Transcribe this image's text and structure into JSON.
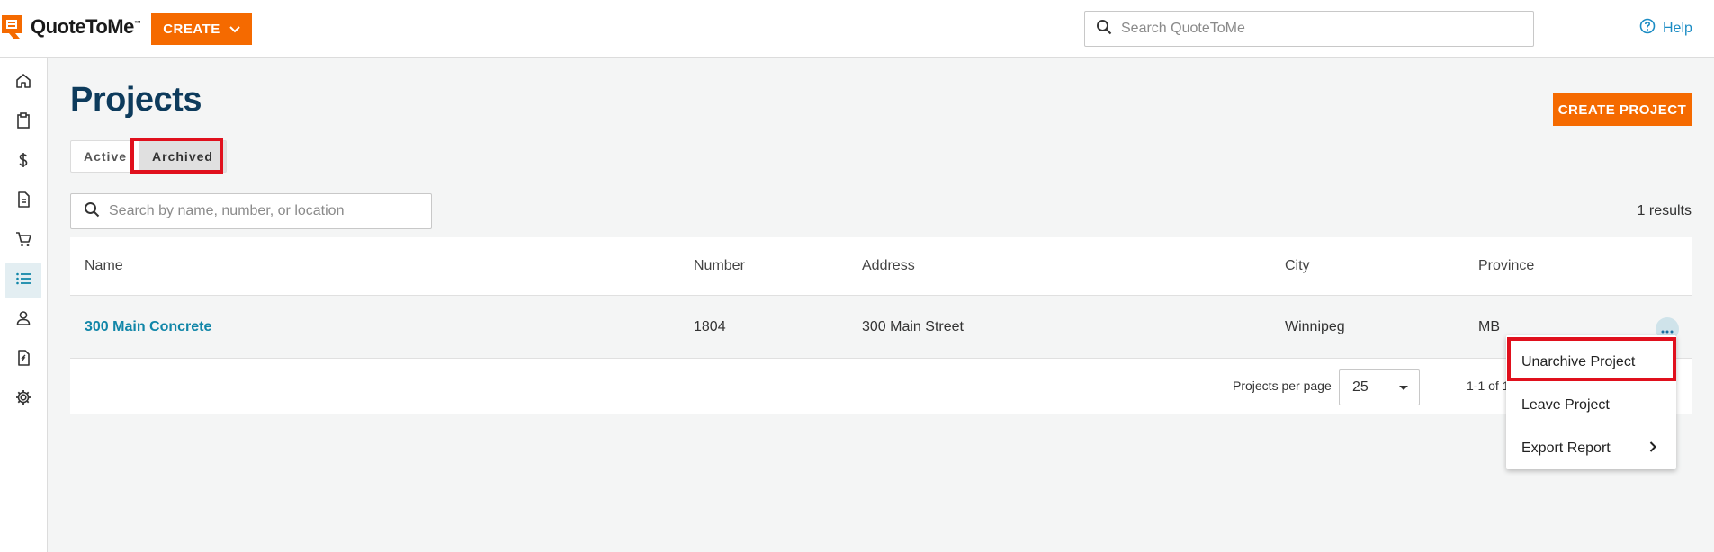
{
  "app": {
    "name": "QuoteToMe",
    "trademark": "™"
  },
  "header": {
    "create_label": "CREATE",
    "search_placeholder": "Search QuoteToMe",
    "help_label": "Help"
  },
  "sidebar": {
    "items": [
      {
        "name": "home",
        "icon": "home-icon"
      },
      {
        "name": "quotes",
        "icon": "clipboard-icon"
      },
      {
        "name": "pricing",
        "icon": "dollar-icon"
      },
      {
        "name": "documents",
        "icon": "document-icon"
      },
      {
        "name": "orders",
        "icon": "cart-icon"
      },
      {
        "name": "projects",
        "icon": "list-icon",
        "active": true
      },
      {
        "name": "contacts",
        "icon": "person-icon"
      },
      {
        "name": "reports",
        "icon": "report-icon"
      },
      {
        "name": "settings",
        "icon": "gear-icon"
      }
    ]
  },
  "page": {
    "title": "Projects",
    "create_project_label": "CREATE PROJECT",
    "tabs": [
      {
        "label": "Active",
        "selected": false
      },
      {
        "label": "Archived",
        "selected": true
      }
    ],
    "search_placeholder": "Search by name, number, or location",
    "results_text": "1 results"
  },
  "table": {
    "columns": [
      "Name",
      "Number",
      "Address",
      "City",
      "Province"
    ],
    "rows": [
      {
        "name": "300 Main Concrete",
        "number": "1804",
        "address": "300 Main Street",
        "city": "Winnipeg",
        "province": "MB"
      }
    ],
    "per_page_label": "Projects per page",
    "per_page_value": "25",
    "range_text": "1-1 of 1"
  },
  "row_menu": {
    "items": [
      {
        "label": "Unarchive Project"
      },
      {
        "label": "Leave Project"
      },
      {
        "label": "Export Report",
        "has_submenu": true
      }
    ]
  },
  "colors": {
    "brand_orange": "#f56a00",
    "title_navy": "#0d3b5c",
    "link_teal": "#1186a8",
    "highlight_red": "#e0101d"
  }
}
